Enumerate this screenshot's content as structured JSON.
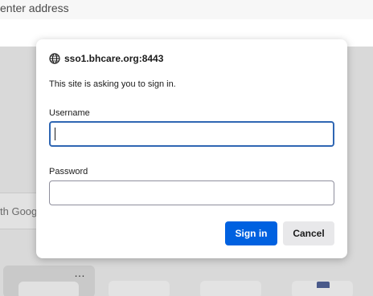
{
  "browser": {
    "address_text": "enter address",
    "search_hint": "th Goog"
  },
  "dialog": {
    "origin": "sso1.bhcare.org:8443",
    "prompt": "This site is asking you to sign in.",
    "username_label": "Username",
    "username_value": "",
    "password_label": "Password",
    "password_value": "",
    "signin_label": "Sign in",
    "cancel_label": "Cancel"
  },
  "newtab": {
    "more_label": "…"
  },
  "colors": {
    "primary_button": "#0061e0",
    "focus_ring": "#2f66b3",
    "secondary_button": "#e8e8ea"
  },
  "icons": {
    "origin_icon": "globe-icon",
    "tile_menu_icon": "more-dots-icon"
  }
}
